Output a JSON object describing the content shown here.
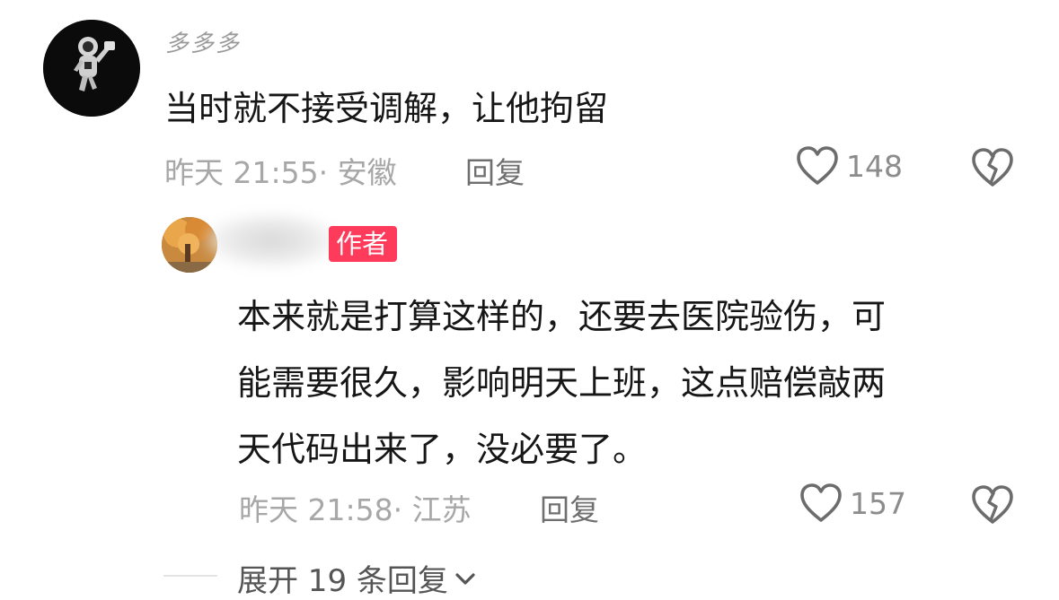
{
  "comment": {
    "username": "多多多",
    "text": "当时就不接受调解，让他拘留",
    "time": "昨天 21:55",
    "location": "· 安徽",
    "reply_label": "回复",
    "likes": "148",
    "avatar_icon": "astronaut-avatar"
  },
  "reply": {
    "author_badge": "作者",
    "text_lines": [
      "本来就是打算这样的，还要去医院验伤，可",
      "能需要很久，影响明天上班，这点赔偿敲两",
      "天代码出来了，没必要了。"
    ],
    "time": "昨天 21:58",
    "location": "· 江苏",
    "reply_label": "回复",
    "likes": "157"
  },
  "expand": {
    "label": "展开 19 条回复"
  },
  "icons": {
    "like": "heart-outline-icon",
    "dislike": "broken-heart-icon",
    "expand": "chevron-down-icon"
  },
  "colors": {
    "author_badge_bg": "#ff3b5c",
    "meta_text": "#a7a7a7",
    "body_text": "#161616"
  }
}
